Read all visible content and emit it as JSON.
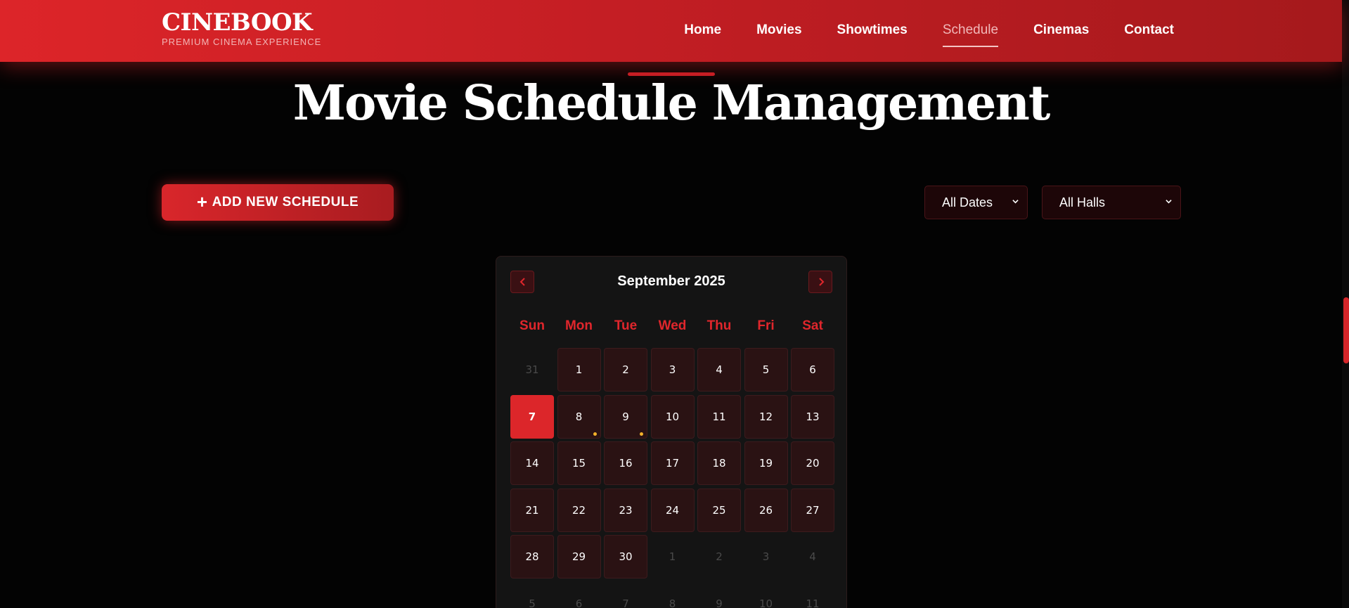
{
  "header": {
    "brand": "CINEBOOK",
    "tagline": "PREMIUM CINEMA EXPERIENCE",
    "nav": [
      {
        "label": "Home"
      },
      {
        "label": "Movies"
      },
      {
        "label": "Showtimes"
      },
      {
        "label": "Schedule",
        "active": true
      },
      {
        "label": "Cinemas"
      },
      {
        "label": "Contact"
      }
    ]
  },
  "main": {
    "title": "Movie Schedule Management",
    "add_button": "ADD NEW SCHEDULE",
    "filters": {
      "dates": "All Dates",
      "halls": "All Halls"
    }
  },
  "calendar": {
    "month_label": "September 2025",
    "weekdays": [
      "Sun",
      "Mon",
      "Tue",
      "Wed",
      "Thu",
      "Fri",
      "Sat"
    ],
    "today": 7,
    "days_with_schedules": [
      8,
      9
    ],
    "weeks": [
      [
        "31",
        "1",
        "2",
        "3",
        "4",
        "5",
        "6"
      ],
      [
        "7",
        "8",
        "9",
        "10",
        "11",
        "12",
        "13"
      ],
      [
        "14",
        "15",
        "16",
        "17",
        "18",
        "19",
        "20"
      ],
      [
        "21",
        "22",
        "23",
        "24",
        "25",
        "26",
        "27"
      ],
      [
        "28",
        "29",
        "30",
        "1",
        "2",
        "3",
        "4"
      ],
      [
        "5",
        "6",
        "7",
        "8",
        "9",
        "10",
        "11"
      ]
    ],
    "current_month_flags": [
      [
        false,
        true,
        true,
        true,
        true,
        true,
        true
      ],
      [
        true,
        true,
        true,
        true,
        true,
        true,
        true
      ],
      [
        true,
        true,
        true,
        true,
        true,
        true,
        true
      ],
      [
        true,
        true,
        true,
        true,
        true,
        true,
        true
      ],
      [
        true,
        true,
        true,
        false,
        false,
        false,
        false
      ],
      [
        false,
        false,
        false,
        false,
        false,
        false,
        false
      ]
    ]
  },
  "colors": {
    "accent": "#dc262a",
    "schedule_dot": "#f2b12a"
  }
}
